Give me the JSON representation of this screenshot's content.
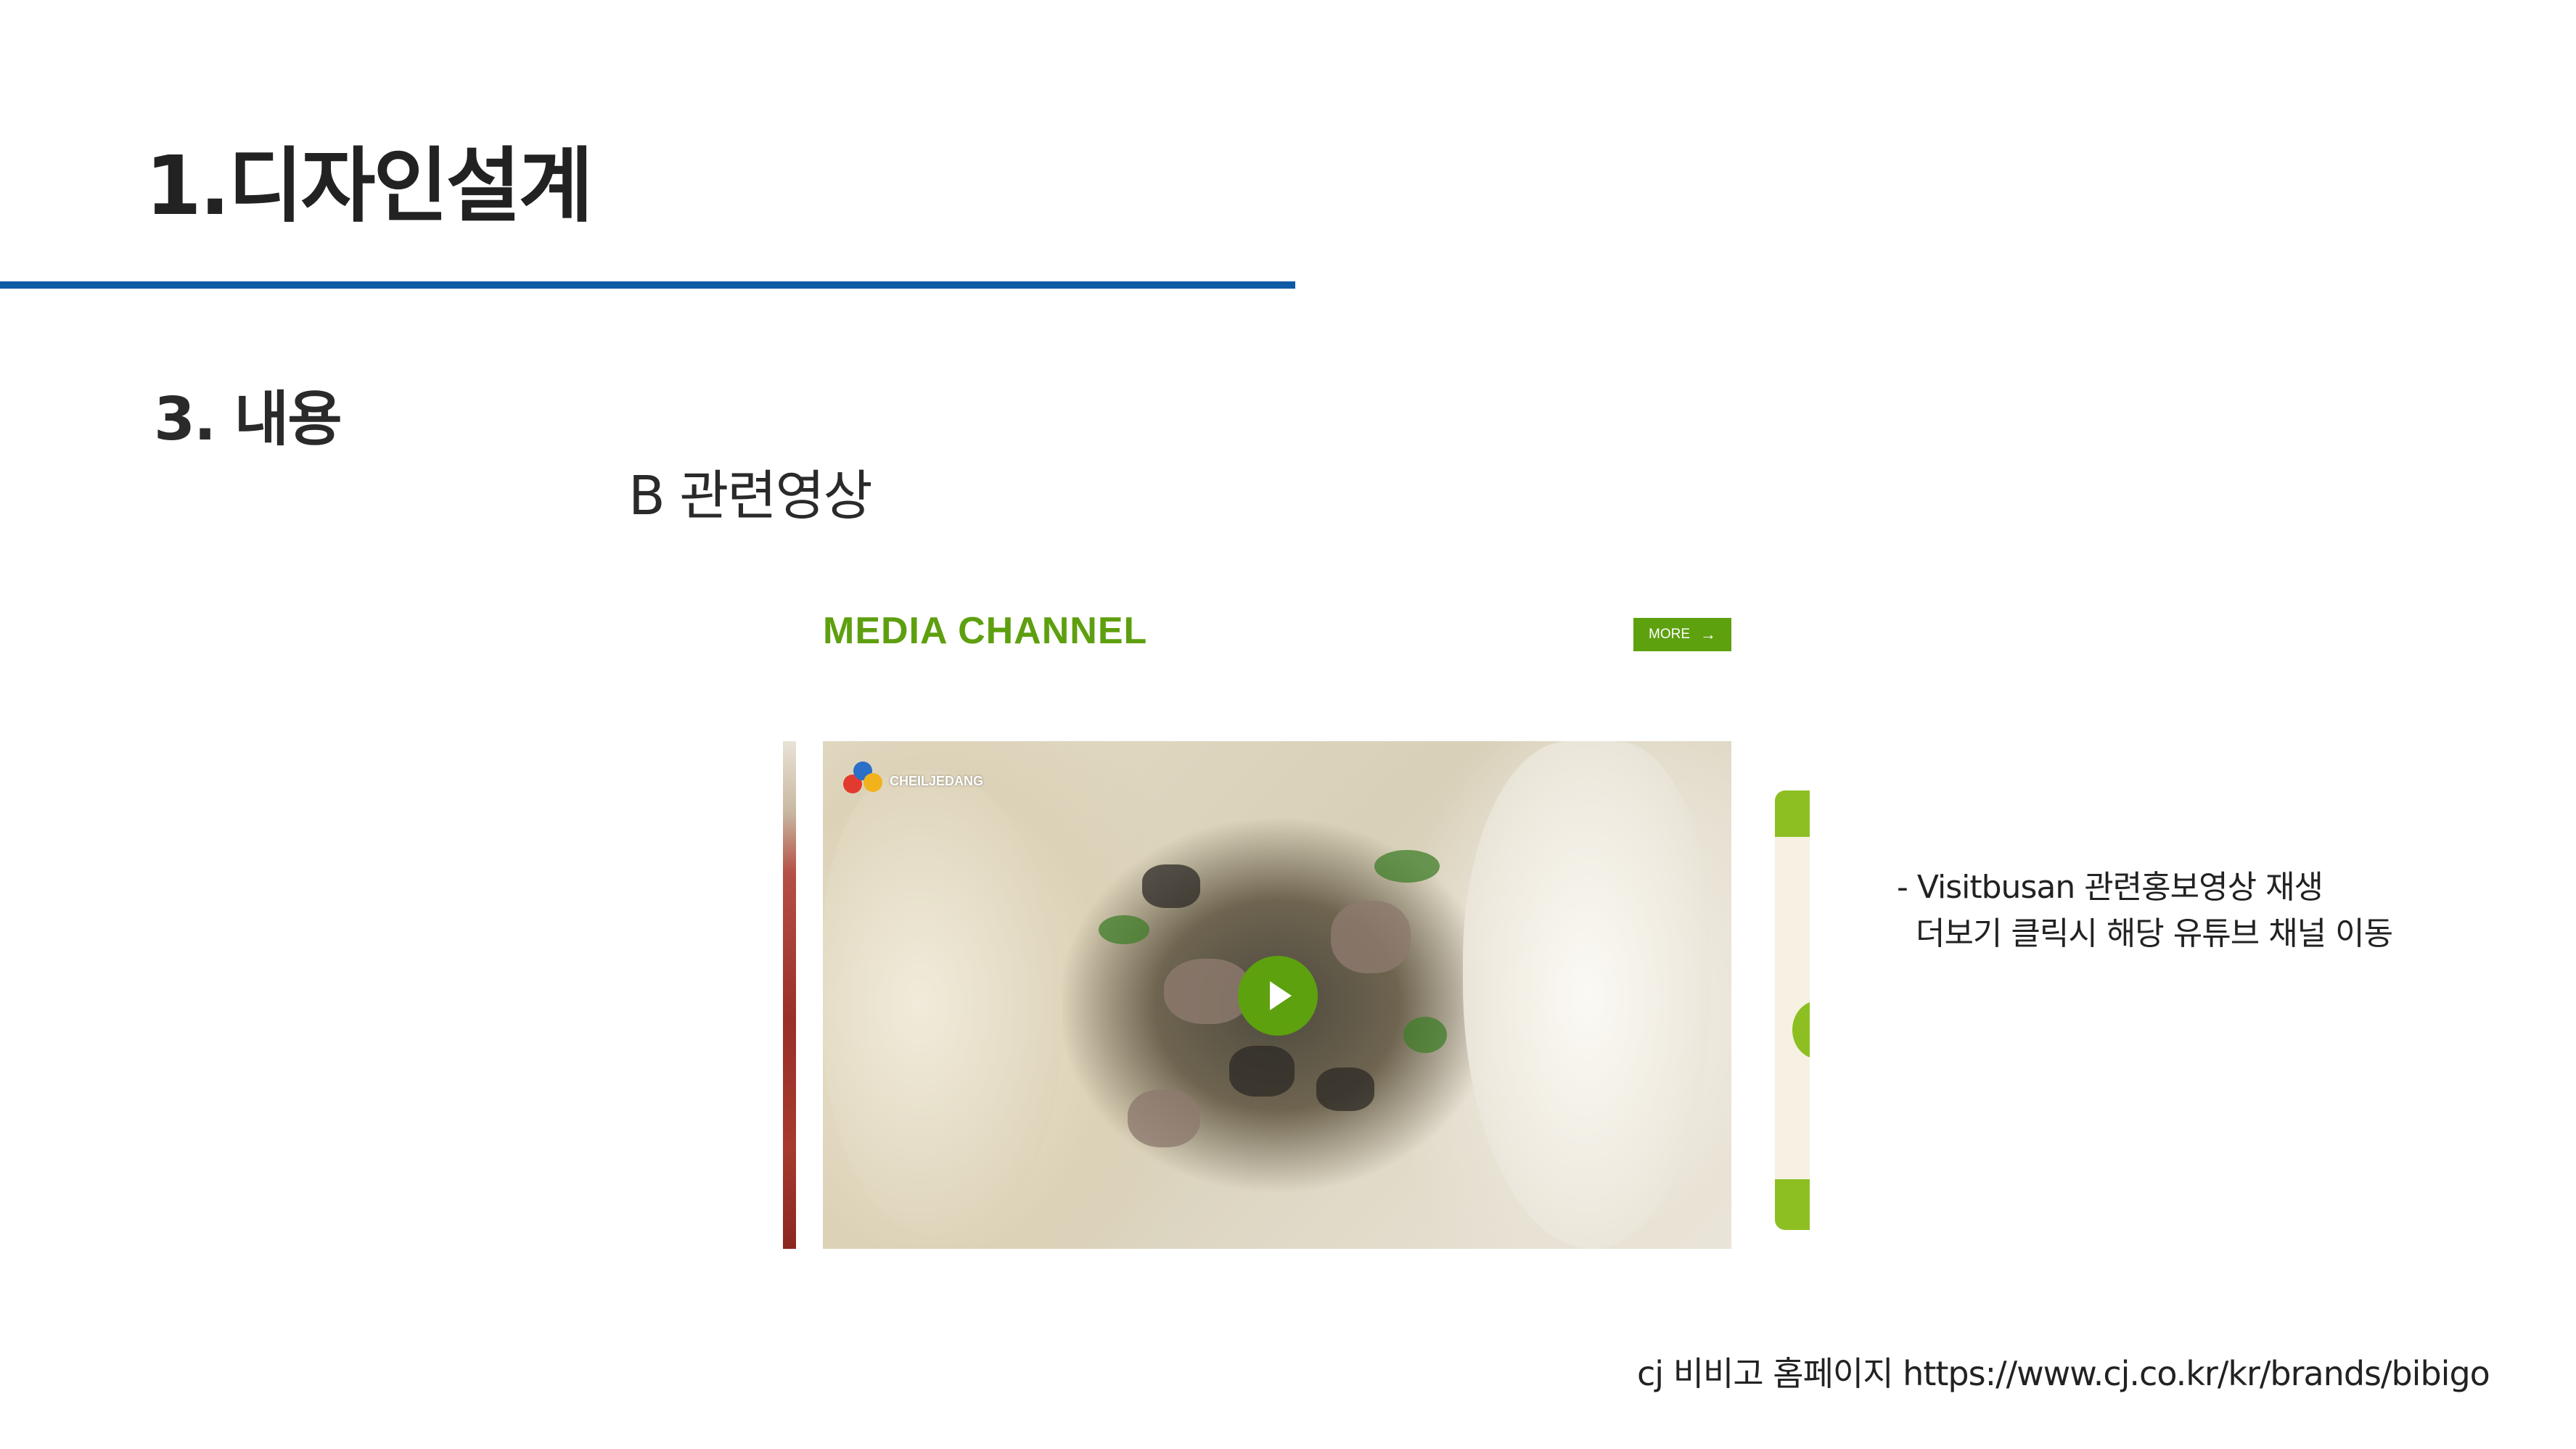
{
  "slide": {
    "title": "1.디자인설계",
    "section": "3. 내용",
    "subsection": "B 관련영상",
    "accent_color": "#0d5aa5"
  },
  "screenshot": {
    "heading": "MEDIA CHANNEL",
    "more_label": "MORE",
    "more_icon": "arrow-right-icon",
    "brand_logo_text": "CHEILJEDANG",
    "play_icon": "play-icon",
    "brand_green": "#5ea10f"
  },
  "description": {
    "line1": "- Visitbusan 관련홍보영상 재생",
    "line2": "  더보기 클릭시 해당 유튜브 채널 이동"
  },
  "source": {
    "text": "cj 비비고 홈페이지 https://www.cj.co.kr/kr/brands/bibigo"
  }
}
